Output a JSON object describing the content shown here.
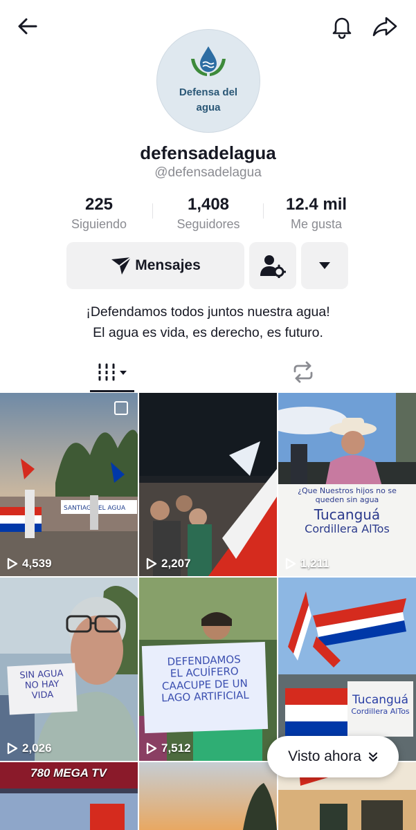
{
  "header": {
    "back_icon": "arrow-left-icon",
    "notification_icon": "bell-icon",
    "share_icon": "share-arrow-icon"
  },
  "profile": {
    "avatar_text_line1": "Defensa del",
    "avatar_text_line2": "agua",
    "username": "defensadelagua",
    "handle": "@defensadelagua",
    "bio_line1": "¡Defendamos todos juntos nuestra agua!",
    "bio_line2": "El agua es vida, es derecho, es futuro."
  },
  "stats": {
    "following_count": "225",
    "following_label": "Siguiendo",
    "followers_count": "1,408",
    "followers_label": "Seguidores",
    "likes_count": "12.4 mil",
    "likes_label": "Me gusta"
  },
  "actions": {
    "message_label": "Mensajes",
    "message_icon": "send-icon",
    "add_friend_icon": "user-settings-icon",
    "more_icon": "caret-down-icon"
  },
  "tabs": {
    "videos_icon": "grid-bars-icon",
    "reposts_icon": "repost-icon"
  },
  "videos": [
    {
      "views": "4,539",
      "pinned": true
    },
    {
      "views": "2,207"
    },
    {
      "views": "1,211",
      "sign": [
        "¿Que Nuestros hijos no se",
        "queden sin agua",
        "Tucanguá",
        "Cordillera AlTos"
      ]
    },
    {
      "views": "2,026",
      "sign": [
        "SIN AGUA",
        "NO HAY",
        "VIDA"
      ]
    },
    {
      "views": "7,512",
      "sign": [
        "DEFENDAMOS",
        "EL ACUÍFERO",
        "CAACUPE DE UN",
        "LAGO ARTIFICIAL"
      ]
    },
    {
      "views": "",
      "sign": [
        "Tucanguá",
        "Cordillera AlTos"
      ]
    },
    {
      "views": "",
      "logo": "780 MEGA TV"
    },
    {
      "views": ""
    },
    {
      "views": ""
    }
  ],
  "floating": {
    "label": "Visto ahora",
    "icon": "double-chevron-down-icon"
  }
}
